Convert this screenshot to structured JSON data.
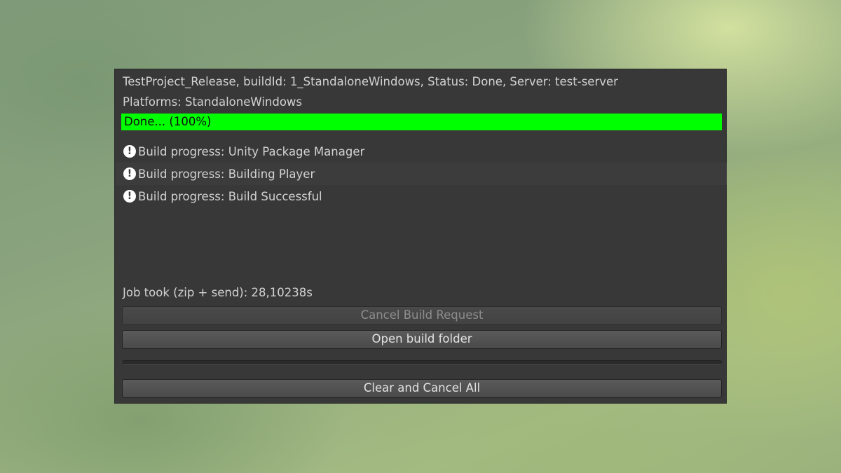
{
  "job": {
    "summary": "TestProject_Release, buildId: 1_StandaloneWindows, Status: Done, Server: test-server",
    "platforms": "Platforms: StandaloneWindows"
  },
  "progress": {
    "label": "Done... (100%)",
    "value_percent": 100,
    "fill_color": "#00ff00"
  },
  "log": {
    "icon": "warning-exclamation-icon",
    "items": [
      {
        "text": "Build progress: Unity Package Manager"
      },
      {
        "text": "Build progress: Building Player"
      },
      {
        "text": "Build progress: Build Successful"
      }
    ]
  },
  "timing": "Job took (zip + send): 28,10238s",
  "buttons": {
    "cancel_build_request": "Cancel Build Request",
    "open_build_folder": "Open build folder",
    "clear_and_cancel_all": "Clear and Cancel All"
  },
  "colors": {
    "panel_background": "#383838",
    "text": "#d2d2d2",
    "progress_fill": "#00ff00"
  }
}
